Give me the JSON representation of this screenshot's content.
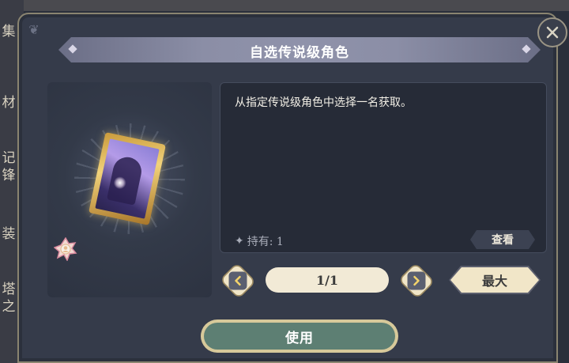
{
  "background": {
    "side_tabs": [
      "集",
      "材",
      "记",
      "锋",
      "装",
      "塔",
      "之"
    ]
  },
  "dialog": {
    "title": "自选传说级角色",
    "close_icon": "close-icon"
  },
  "item": {
    "icon": "legendary-portrait-frame-icon",
    "rarity_icon": "rarity-badge-icon"
  },
  "description": {
    "text": "从指定传说级角色中选择一名获取。",
    "owned_label": "持有: 1",
    "view_button": "查看"
  },
  "quantity": {
    "value": "1/1",
    "max_button": "最大"
  },
  "use_button": "使用",
  "colors": {
    "panel": "#353b4a",
    "title_banner": "#8b8ea6",
    "use_button": "#5d7f73",
    "cream": "#f1e6c8"
  }
}
